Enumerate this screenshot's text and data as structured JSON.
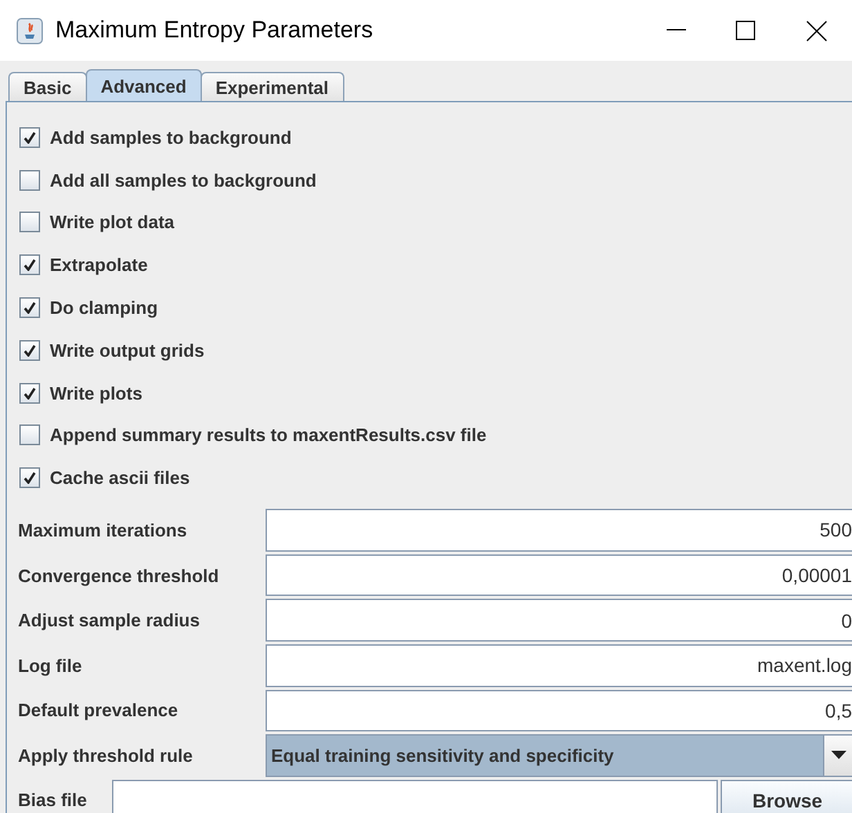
{
  "window": {
    "title": "Maximum Entropy Parameters"
  },
  "tabs": [
    {
      "label": "Basic",
      "selected": false
    },
    {
      "label": "Advanced",
      "selected": true
    },
    {
      "label": "Experimental",
      "selected": false
    }
  ],
  "checkboxes": [
    {
      "label": "Add samples to background",
      "checked": true
    },
    {
      "label": "Add all samples to background",
      "checked": false
    },
    {
      "label": "Write plot data",
      "checked": false
    },
    {
      "label": "Extrapolate",
      "checked": true
    },
    {
      "label": "Do clamping",
      "checked": true
    },
    {
      "label": "Write output grids",
      "checked": true
    },
    {
      "label": "Write plots",
      "checked": true
    },
    {
      "label": "Append summary results to maxentResults.csv file",
      "checked": false
    },
    {
      "label": "Cache ascii files",
      "checked": true
    }
  ],
  "fields": [
    {
      "kind": "text",
      "label": "Maximum iterations",
      "value": "500"
    },
    {
      "kind": "text",
      "label": "Convergence threshold",
      "value": "0,00001"
    },
    {
      "kind": "text",
      "label": "Adjust sample radius",
      "value": "0"
    },
    {
      "kind": "text",
      "label": "Log file",
      "value": "maxent.log"
    },
    {
      "kind": "text",
      "label": "Default prevalence",
      "value": "0,5"
    },
    {
      "kind": "select",
      "label": "Apply threshold rule",
      "value": "Equal training sensitivity and specificity"
    }
  ],
  "bias_file": {
    "label": "Bias file",
    "button": "Browse"
  }
}
